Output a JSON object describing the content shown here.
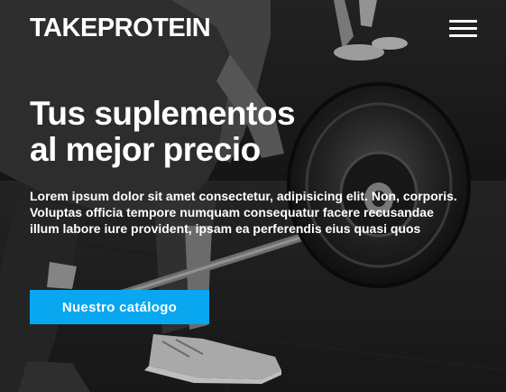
{
  "header": {
    "brand": "TAKEPROTEIN",
    "menu_icon": "hamburger-menu-icon"
  },
  "hero": {
    "title_line1": "Tus suplementos",
    "title_line2": "al mejor precio",
    "description": "Lorem ipsum dolor sit amet consectetur, adipisicing elit. Non, corporis. Voluptas officia tempore numquam consequatur facere recusandae illum labore iure provident, ipsam ea perferendis eius quasi quos",
    "cta_label": "Nuestro catálogo",
    "background_image": "monochrome photo of a person lifting a loaded barbell in a gym"
  },
  "colors": {
    "accent": "#08a7f0",
    "text": "#ffffff"
  }
}
